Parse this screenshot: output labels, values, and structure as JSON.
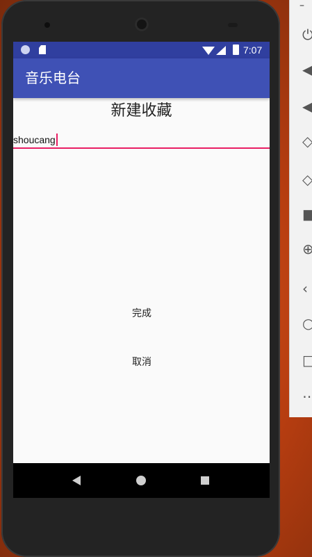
{
  "status_bar": {
    "time": "7:07"
  },
  "app_bar": {
    "title": "音乐电台"
  },
  "dialog": {
    "title": "新建收藏",
    "input_value": "shoucang",
    "done_label": "完成",
    "cancel_label": "取消"
  },
  "nav_bar": {
    "icons": [
      "back-icon",
      "home-icon",
      "recents-icon"
    ]
  },
  "emulator_toolbar": {
    "icons": [
      "minimize-icon",
      "power-icon",
      "volume-up-icon",
      "volume-down-icon",
      "rotate-left-icon",
      "rotate-right-icon",
      "camera-icon",
      "zoom-icon",
      "back-icon",
      "home-icon",
      "overview-icon",
      "more-icon"
    ]
  },
  "colors": {
    "status_bar": "#303f9f",
    "app_bar": "#3f51b5",
    "accent": "#e91e63"
  }
}
